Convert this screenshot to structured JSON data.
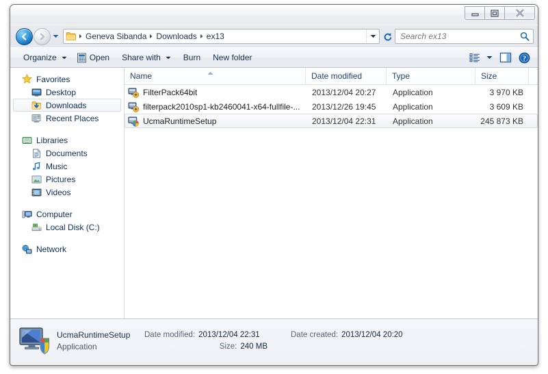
{
  "window": {
    "buttons": {
      "minimize": "Minimize",
      "maximize": "Maximize",
      "close": "Close"
    }
  },
  "address": {
    "back": "Back",
    "forward": "Forward",
    "history": "Recent pages",
    "refresh": "Refresh",
    "crumbs": [
      "Geneva Sibanda",
      "Downloads",
      "ex13"
    ],
    "dropdown": "Previous locations"
  },
  "search": {
    "placeholder": "Search ex13",
    "value": ""
  },
  "toolbar": {
    "organize": "Organize",
    "open": "Open",
    "share_with": "Share with",
    "burn": "Burn",
    "new_folder": "New folder",
    "view_options": "Change your view",
    "preview_pane": "Show the preview pane",
    "help": "Get help"
  },
  "sidebar": {
    "groups": [
      {
        "label": "Favorites",
        "icon": "star-icon",
        "items": [
          {
            "label": "Desktop",
            "icon": "desktop-icon",
            "selected": false
          },
          {
            "label": "Downloads",
            "icon": "downloads-icon",
            "selected": true
          },
          {
            "label": "Recent Places",
            "icon": "recent-places-icon",
            "selected": false
          }
        ]
      },
      {
        "label": "Libraries",
        "icon": "libraries-icon",
        "items": [
          {
            "label": "Documents",
            "icon": "documents-icon",
            "selected": false
          },
          {
            "label": "Music",
            "icon": "music-icon",
            "selected": false
          },
          {
            "label": "Pictures",
            "icon": "pictures-icon",
            "selected": false
          },
          {
            "label": "Videos",
            "icon": "videos-icon",
            "selected": false
          }
        ]
      },
      {
        "label": "Computer",
        "icon": "computer-icon",
        "items": [
          {
            "label": "Local Disk (C:)",
            "icon": "harddisk-icon",
            "selected": false
          }
        ]
      },
      {
        "label": "Network",
        "icon": "network-icon",
        "items": []
      }
    ]
  },
  "filelist": {
    "columns": {
      "name": "Name",
      "date_modified": "Date modified",
      "type": "Type",
      "size": "Size"
    },
    "sort_column": "Name",
    "sort_direction": "ascending",
    "rows": [
      {
        "name": "FilterPack64bit",
        "date_modified": "2013/12/04 20:27",
        "type": "Application",
        "size": "3 970 KB",
        "icon": "installer-icon",
        "selected": false
      },
      {
        "name": "filterpack2010sp1-kb2460041-x64-fullfile-...",
        "date_modified": "2013/12/26 19:45",
        "type": "Application",
        "size": "3 609 KB",
        "icon": "installer-icon",
        "selected": false
      },
      {
        "name": "UcmaRuntimeSetup",
        "date_modified": "2013/12/04 22:31",
        "type": "Application",
        "size": "245 873 KB",
        "icon": "setup-shield-icon",
        "selected": true
      }
    ]
  },
  "details": {
    "title": "UcmaRuntimeSetup",
    "subtitle": "Application",
    "date_modified_label": "Date modified:",
    "date_modified_value": "2013/12/04 22:31",
    "size_label": "Size:",
    "size_value": "240 MB",
    "date_created_label": "Date created:",
    "date_created_value": "2013/12/04 20:20",
    "icon": "setup-shield-large-icon"
  },
  "colors": {
    "accent": "#1565b5",
    "crumb_text": "#1b2f4d",
    "header_text": "#20456d"
  }
}
